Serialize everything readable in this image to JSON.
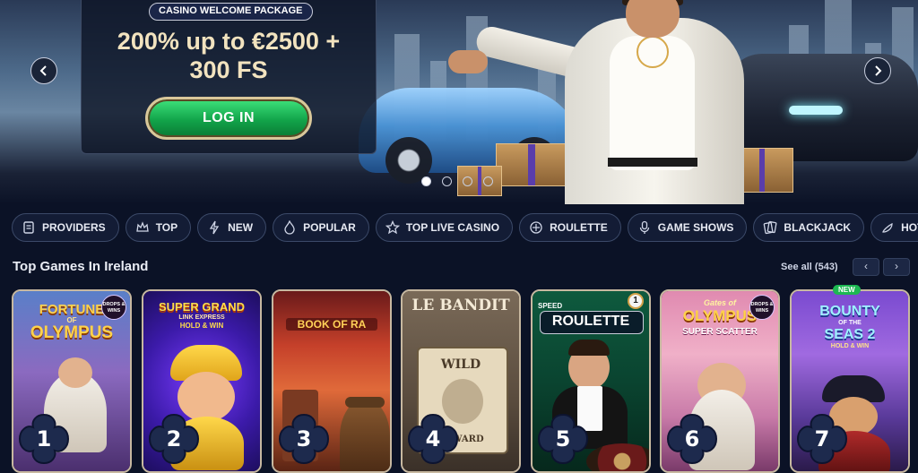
{
  "hero": {
    "tag": "CASINO WELCOME PACKAGE",
    "title_line1": "200% up to €2500 +",
    "title_line2": "300 FS",
    "login_label": "LOG IN",
    "prev_icon": "chevron-left-icon",
    "next_icon": "chevron-right-icon",
    "slides": 4,
    "active_slide": 1
  },
  "categories": [
    {
      "label": "PROVIDERS",
      "icon": "providers-icon"
    },
    {
      "label": "TOP",
      "icon": "crown-icon"
    },
    {
      "label": "NEW",
      "icon": "lightning-icon"
    },
    {
      "label": "POPULAR",
      "icon": "fire-icon"
    },
    {
      "label": "TOP LIVE CASINO",
      "icon": "star-icon"
    },
    {
      "label": "ROULETTE",
      "icon": "roulette-icon"
    },
    {
      "label": "GAME SHOWS",
      "icon": "microphone-icon"
    },
    {
      "label": "BLACKJACK",
      "icon": "cards-icon"
    },
    {
      "label": "HOT",
      "icon": "chili-icon"
    }
  ],
  "section": {
    "title": "Top Games In Ireland",
    "see_all": "See all (543)"
  },
  "games": [
    {
      "rank": "1",
      "title_a": "FORTUNE",
      "title_b": "OLYMPUS",
      "small": "OF",
      "badge": "DROPS & WINS"
    },
    {
      "rank": "2",
      "title_a": "SUPER GRAND",
      "title_b": "LINK EXPRESS",
      "small": "HOLD & WIN"
    },
    {
      "rank": "3",
      "title_a": "BOOK OF RA"
    },
    {
      "rank": "4",
      "title_a": "LE BANDIT",
      "title_b": "WILD",
      "small": "REWARD"
    },
    {
      "rank": "5",
      "title_a": "ROULETTE",
      "small": "SPEED",
      "counter": "1"
    },
    {
      "rank": "6",
      "title_a": "OLYMPUS",
      "title_b": "SUPER SCATTER",
      "small": "Gates of",
      "badge": "DROPS & WINS"
    },
    {
      "rank": "7",
      "title_a": "BOUNTY",
      "title_b": "SEAS 2",
      "small": "OF THE",
      "small_b": "HOLD & WIN",
      "badge_new": "NEW"
    }
  ],
  "colors": {
    "background": "#0b1226",
    "accent_green": "#12a44a",
    "gold": "#d9c79a"
  }
}
